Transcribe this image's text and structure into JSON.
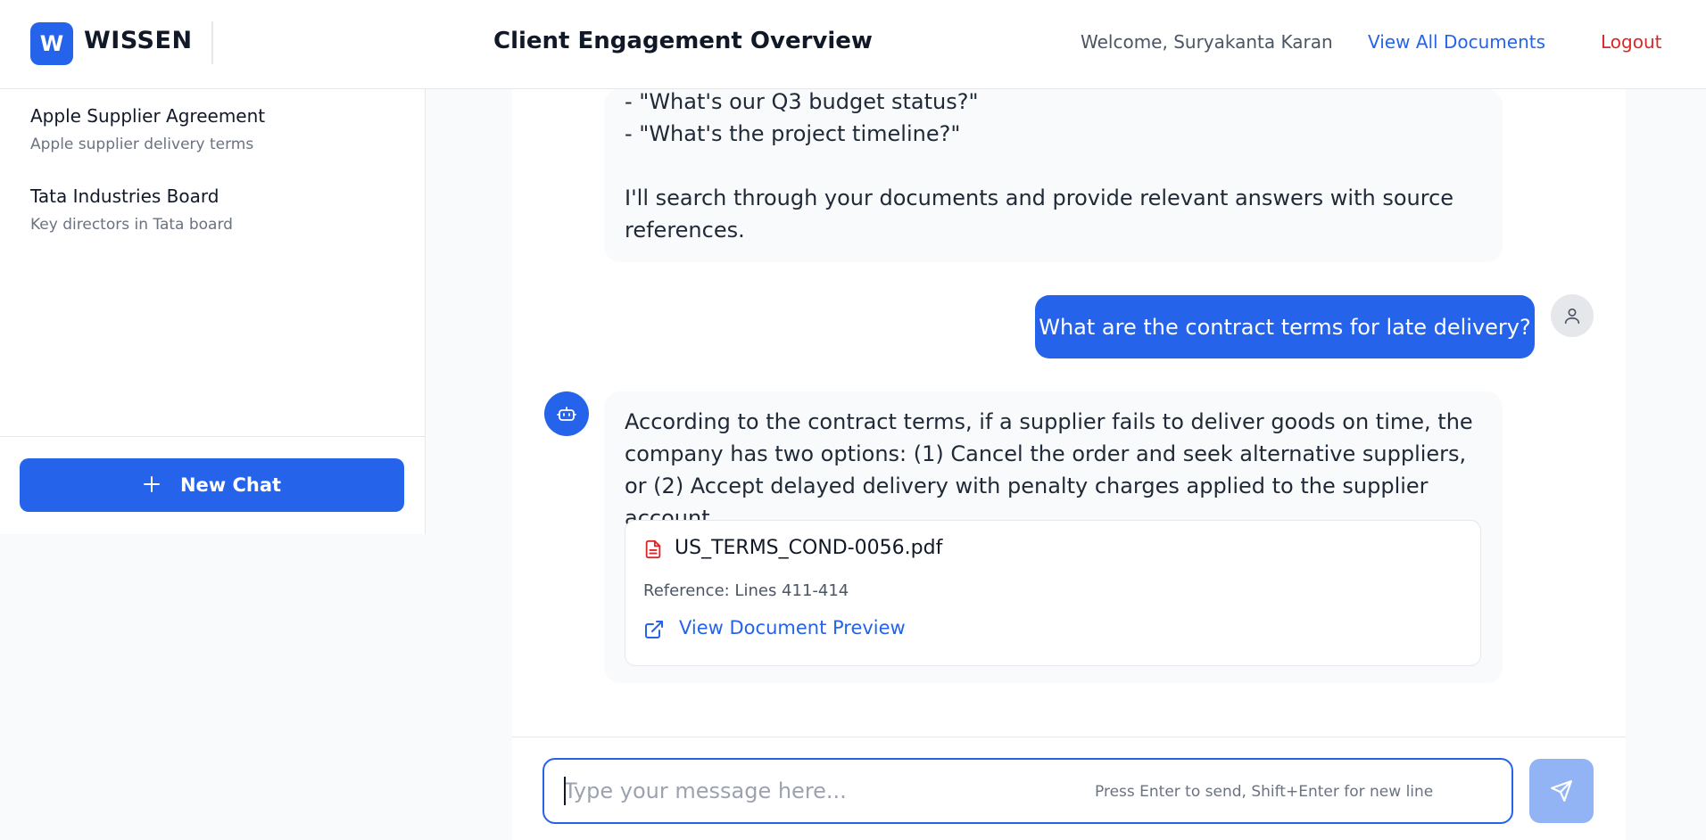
{
  "header": {
    "logo_letter": "W",
    "brand": "WISSEN",
    "title": "Client Engagement Overview",
    "welcome": "Welcome, Suryakanta Karan",
    "view_all_label": "View All Documents",
    "logout_label": "Logout"
  },
  "sidebar": {
    "conversations": [
      {
        "title": "Apple Supplier Agreement",
        "subtitle": "Apple supplier delivery terms"
      },
      {
        "title": "Tata Industries Board",
        "subtitle": "Key directors in Tata board"
      }
    ],
    "new_chat_label": "New Chat"
  },
  "chat": {
    "messages": [
      {
        "role": "assistant",
        "text": "- \"What's our Q3 budget status?\"\n- \"What's the project timeline?\"\n\nI'll search through your documents and provide relevant answers with source references."
      },
      {
        "role": "user",
        "text": "What are the contract terms for late delivery?"
      },
      {
        "role": "assistant",
        "text": "According to the contract terms, if a supplier fails to deliver goods on time, the company has two options: (1) Cancel the order and seek alternative suppliers, or (2) Accept delayed delivery with penalty charges applied to the supplier account.",
        "source": {
          "file": "US_TERMS_COND-0056.pdf",
          "reference": "Reference: Lines 411-414",
          "preview_label": "View Document Preview"
        }
      }
    ]
  },
  "composer": {
    "placeholder": "Type your message here...",
    "value": "",
    "hint": "Press Enter to send, Shift+Enter for new line"
  },
  "colors": {
    "accent": "#2563eb",
    "logout": "#dc2626",
    "file_icon": "#dc2626",
    "send_disabled": "#93b4f4"
  },
  "icons": {
    "user_avatar": "user-icon",
    "bot_avatar": "bot-icon",
    "file": "file-text-icon",
    "preview": "external-link-icon",
    "send": "send-icon",
    "new_chat": "plus-icon"
  }
}
